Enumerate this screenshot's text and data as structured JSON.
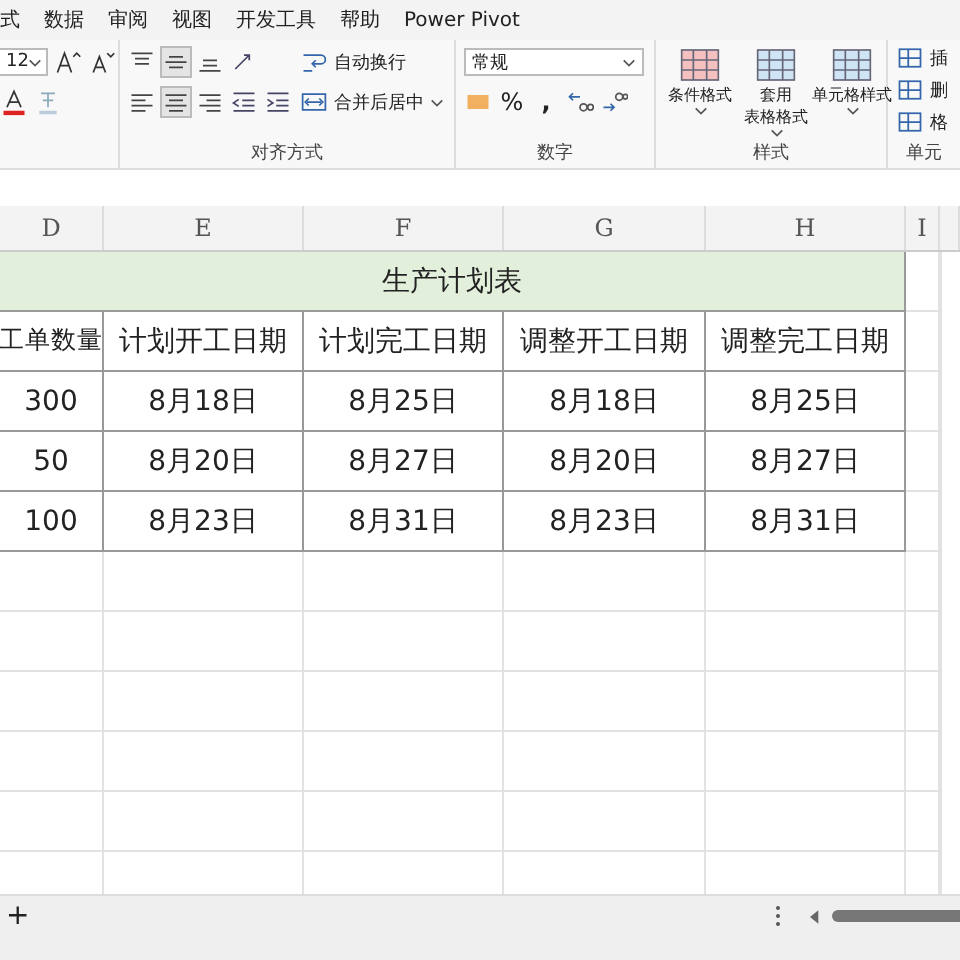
{
  "menu_tabs": [
    "式",
    "数据",
    "审阅",
    "视图",
    "开发工具",
    "帮助",
    "Power Pivot"
  ],
  "ribbon": {
    "font_group": {
      "font_size": "12"
    },
    "alignment_group": {
      "label": "对齐方式",
      "wrap_text": "自动换行",
      "merge_center": "合并后居中"
    },
    "number_group": {
      "label": "数字",
      "format": "常规",
      "percent": "%",
      "comma": ","
    },
    "styles_group": {
      "label": "样式",
      "buttons": [
        {
          "lines": [
            "条件格式"
          ]
        },
        {
          "lines": [
            "套用",
            "表格格式"
          ]
        },
        {
          "lines": [
            "单元格样式"
          ]
        }
      ]
    },
    "cells_group": {
      "label": "单元",
      "buttons": [
        "插",
        "删",
        "格"
      ]
    }
  },
  "column_headers": [
    "D",
    "E",
    "F",
    "G",
    "H",
    "I"
  ],
  "sheet": {
    "title": "生产计划表",
    "header": [
      "工单数量",
      "计划开工日期",
      "计划完工日期",
      "调整开工日期",
      "调整完工日期"
    ],
    "rows": [
      [
        "300",
        "8月18日",
        "8月25日",
        "8月18日",
        "8月25日"
      ],
      [
        "50",
        "8月20日",
        "8月27日",
        "8月20日",
        "8月27日"
      ],
      [
        "100",
        "8月23日",
        "8月31日",
        "8月23日",
        "8月31日"
      ]
    ]
  },
  "sheet_bar": {
    "add_label": "+"
  }
}
